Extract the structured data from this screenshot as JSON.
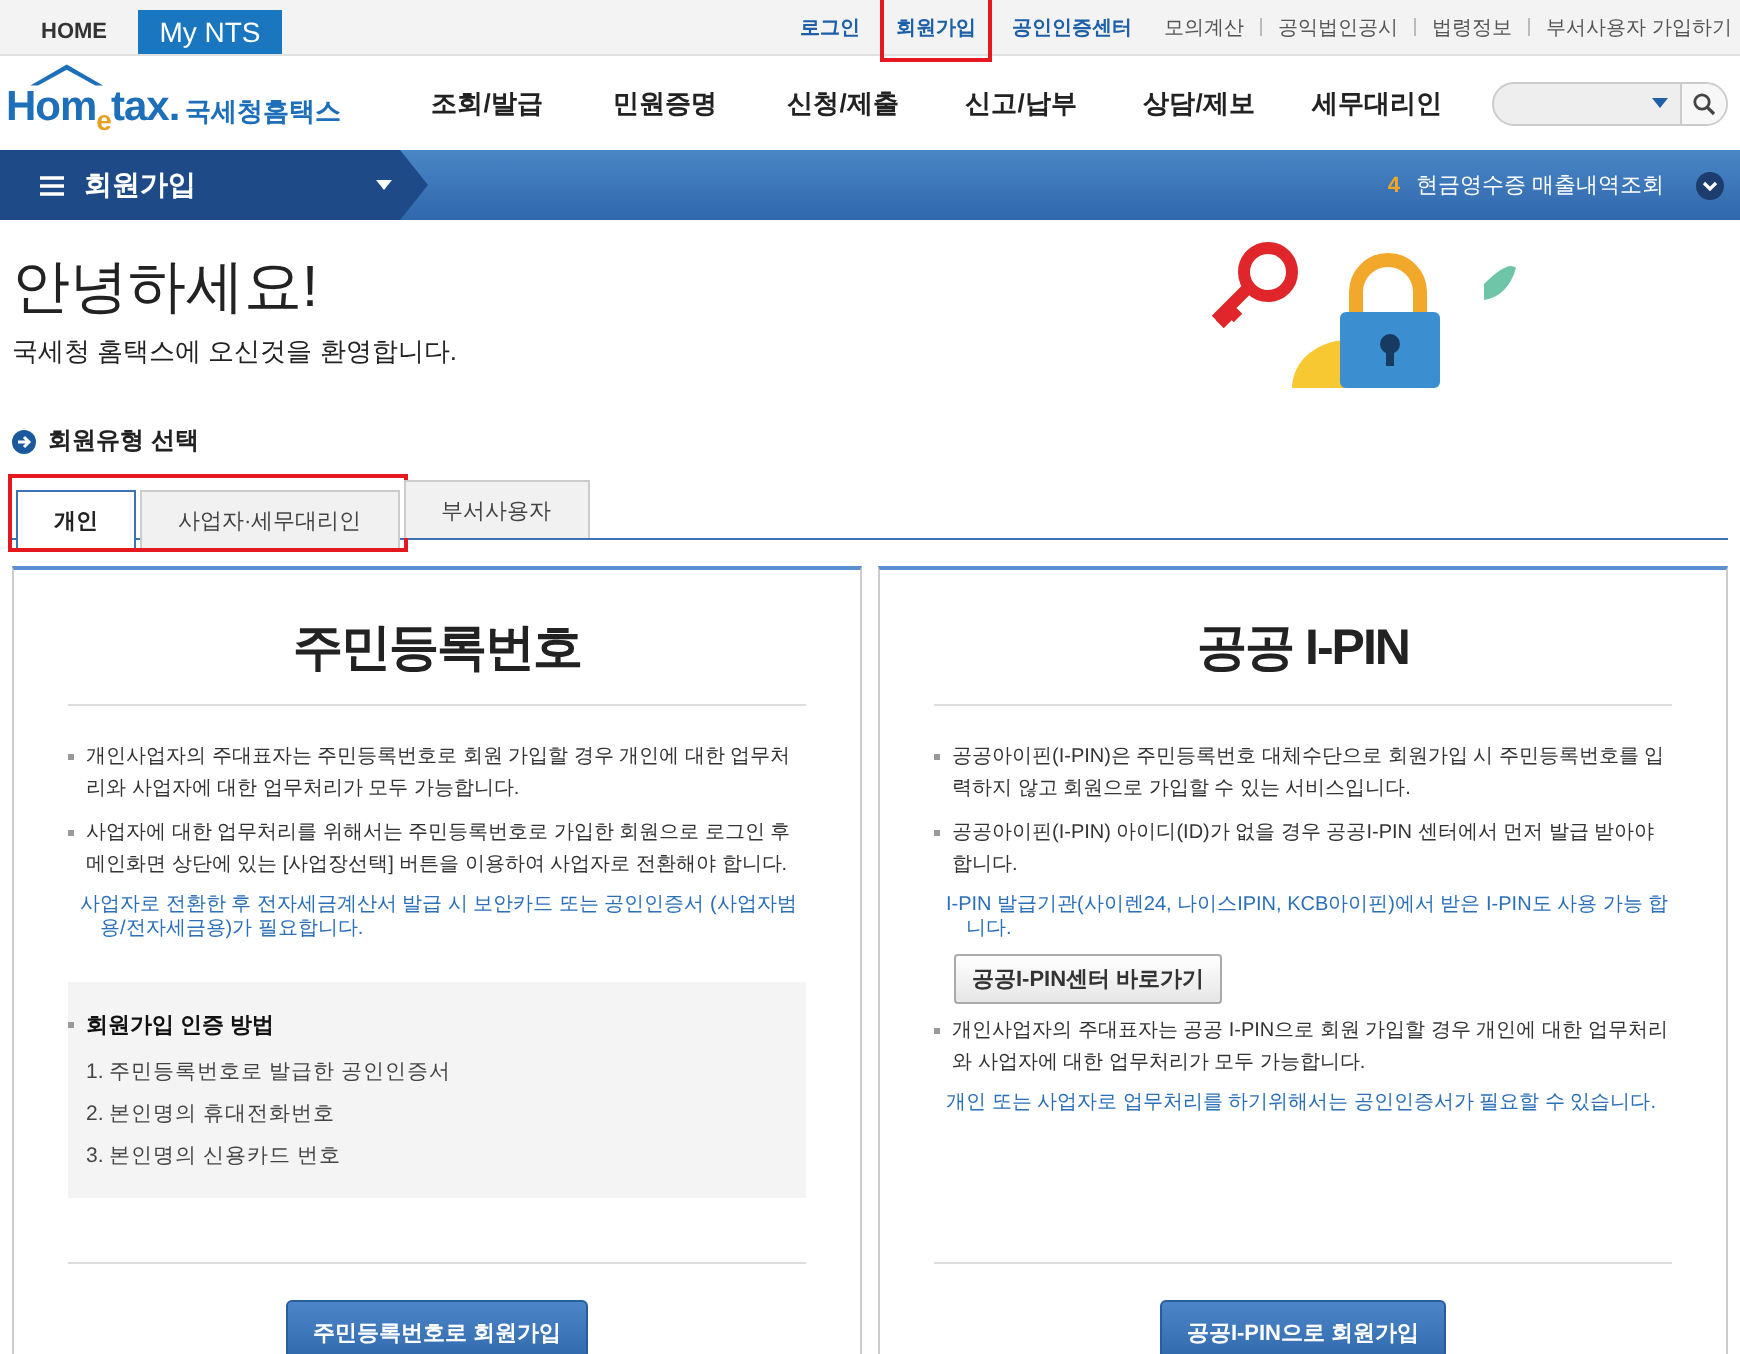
{
  "top_bar": {
    "home_tabs": [
      {
        "label": "HOME",
        "selected": false
      },
      {
        "label": "My NTS",
        "selected": true
      }
    ],
    "links": [
      {
        "label": "로그인",
        "kind": "primary",
        "highlighted": false
      },
      {
        "label": "회원가입",
        "kind": "primary",
        "highlighted": true
      },
      {
        "label": "공인인증센터",
        "kind": "primary",
        "highlighted": false
      },
      {
        "label": "모의계산",
        "kind": "secondary",
        "highlighted": false
      },
      {
        "label": "공익법인공시",
        "kind": "secondary",
        "highlighted": false
      },
      {
        "label": "법령정보",
        "kind": "secondary",
        "highlighted": false
      },
      {
        "label": "부서사용자 가입하기",
        "kind": "secondary",
        "highlighted": false
      }
    ]
  },
  "logo": {
    "wordmark": "Hom$_{e}$tax.",
    "name": "국세청홈택스"
  },
  "menu": [
    "조회/발급",
    "민원증명",
    "신청/제출",
    "신고/납부",
    "상담/제보",
    "세무대리인"
  ],
  "location_bar": {
    "title": "회원가입",
    "notice_number": "4",
    "notice": "현금영수증 매출내역조회"
  },
  "greeting": "안녕하세요!",
  "subtitle": "국세청 홈택스에 오신것을 환영합니다.",
  "section_title": "회원유형 선택",
  "tabs": [
    {
      "label": "개인",
      "selected": true,
      "highlighted": true
    },
    {
      "label": "사업자·세무대리인",
      "selected": false,
      "highlighted": true
    },
    {
      "label": "부서사용자",
      "selected": false,
      "highlighted": false
    }
  ],
  "panels": [
    {
      "title": "주민등록번호",
      "items": [
        {
          "kind": "bullet",
          "text": "개인사업자의 주대표자는 주민등록번호로 회원 가입할 경우 개인에 대한 업무처리와 사업자에 대한 업무처리가 모두 가능합니다."
        },
        {
          "kind": "bullet",
          "text": "사업자에 대한 업무처리를 위해서는 주민등록번호로 가입한 회원으로 로그인 후 메인화면 상단에 있는 [사업장선택] 버튼을 이용하여 사업자로 전환해야 합니다."
        },
        {
          "kind": "note",
          "text": "사업자로 전환한 후 전자세금계산서 발급 시 보안카드 또는 공인인증서 (사업자범용/전자세금용)가 필요합니다."
        },
        {
          "kind": "method_box",
          "heading": "회원가입 인증 방법",
          "steps": [
            "1. 주민등록번호로 발급한 공인인증서",
            "2. 본인명의 휴대전화번호",
            "3. 본인명의 신용카드 번호"
          ]
        }
      ],
      "action": "주민등록번호로 회원가입"
    },
    {
      "title": "공공 I-PIN",
      "items": [
        {
          "kind": "bullet",
          "text": "공공아이핀(I-PIN)은 주민등록번호 대체수단으로 회원가입 시 주민등록번호를 입력하지 않고 회원으로 가입할 수 있는 서비스입니다."
        },
        {
          "kind": "bullet",
          "text": "공공아이핀(I-PIN) 아이디(ID)가 없을 경우 공공I-PIN 센터에서 먼저 발급 받아야 합니다."
        },
        {
          "kind": "note",
          "text": "I-PIN 발급기관(사이렌24, 나이스IPIN, KCB아이핀)에서 받은 I-PIN도 사용 가능 합니다."
        },
        {
          "kind": "link_button",
          "text": "공공I-PIN센터 바로가기"
        },
        {
          "kind": "bullet",
          "text": "개인사업자의 주대표자는 공공 I-PIN으로 회원 가입할 경우 개인에 대한 업무처리와 사업자에 대한 업무처리가 모두 가능합니다."
        },
        {
          "kind": "note",
          "text": "개인 또는 사업자로 업무처리를 하기위해서는 공인인증서가 필요할 수 있습니다."
        }
      ],
      "action": "공공I-PIN으로 회원가입"
    }
  ]
}
